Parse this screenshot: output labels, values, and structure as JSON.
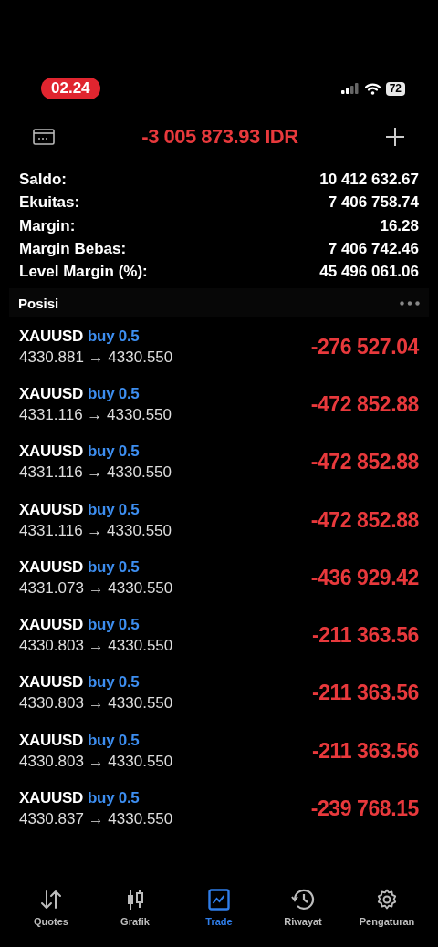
{
  "status_bar": {
    "time": "02.24",
    "battery": "72"
  },
  "header": {
    "balance": "-3 005 873.93 IDR"
  },
  "summary": [
    {
      "label": "Saldo:",
      "value": "10 412 632.67"
    },
    {
      "label": "Ekuitas:",
      "value": "7 406 758.74"
    },
    {
      "label": "Margin:",
      "value": "16.28"
    },
    {
      "label": "Margin Bebas:",
      "value": "7 406 742.46"
    },
    {
      "label": "Level Margin (%):",
      "value": "45 496 061.06"
    }
  ],
  "positions_section": {
    "title": "Posisi"
  },
  "positions": [
    {
      "symbol": "XAUUSD",
      "side": "buy 0.5",
      "prices": "4330.881 → 4330.550",
      "profit": "-276 527.04"
    },
    {
      "symbol": "XAUUSD",
      "side": "buy 0.5",
      "prices": "4331.116 → 4330.550",
      "profit": "-472 852.88"
    },
    {
      "symbol": "XAUUSD",
      "side": "buy 0.5",
      "prices": "4331.116 → 4330.550",
      "profit": "-472 852.88"
    },
    {
      "symbol": "XAUUSD",
      "side": "buy 0.5",
      "prices": "4331.116 → 4330.550",
      "profit": "-472 852.88"
    },
    {
      "symbol": "XAUUSD",
      "side": "buy 0.5",
      "prices": "4331.073 → 4330.550",
      "profit": "-436 929.42"
    },
    {
      "symbol": "XAUUSD",
      "side": "buy 0.5",
      "prices": "4330.803 → 4330.550",
      "profit": "-211 363.56"
    },
    {
      "symbol": "XAUUSD",
      "side": "buy 0.5",
      "prices": "4330.803 → 4330.550",
      "profit": "-211 363.56"
    },
    {
      "symbol": "XAUUSD",
      "side": "buy 0.5",
      "prices": "4330.803 → 4330.550",
      "profit": "-211 363.56"
    },
    {
      "symbol": "XAUUSD",
      "side": "buy 0.5",
      "prices": "4330.837 → 4330.550",
      "profit": "-239 768.15"
    }
  ],
  "tab_bar": [
    {
      "label": "Quotes",
      "selected": false
    },
    {
      "label": "Grafik",
      "selected": false
    },
    {
      "label": "Trade",
      "selected": true
    },
    {
      "label": "Riwayat",
      "selected": false
    },
    {
      "label": "Pengaturan",
      "selected": false
    }
  ]
}
